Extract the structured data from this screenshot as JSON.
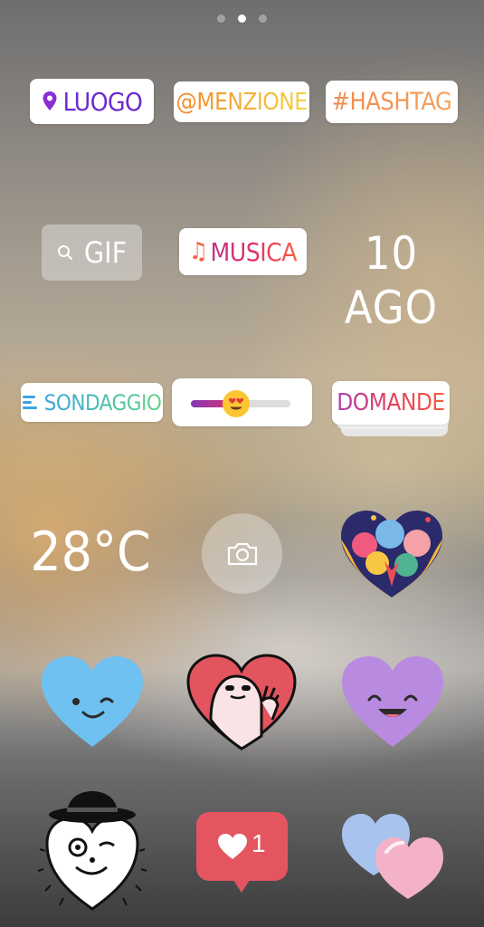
{
  "page_dots": {
    "count": 3,
    "active_index": 1
  },
  "row1": {
    "location": {
      "label": "LUOGO",
      "icon": "location-pin-icon",
      "color": "#6b2bd0"
    },
    "mention": {
      "label": "@MENZIONE"
    },
    "hashtag": {
      "label": "#HASHTAG"
    }
  },
  "row2": {
    "gif": {
      "label": "GIF",
      "icon": "search-icon"
    },
    "music": {
      "label": "MUSICA",
      "icon": "music-note-icon"
    },
    "date": {
      "label": "10 AGO"
    }
  },
  "row3": {
    "poll": {
      "label": "SONDAGGIO",
      "icon": "poll-lines-icon"
    },
    "emoji_slider": {
      "emoji": "heart-eyes-emoji",
      "level": 0.45
    },
    "questions": {
      "label": "DOMANDE"
    }
  },
  "row4": {
    "temperature": {
      "label": "28°C"
    },
    "camera": {
      "icon": "camera-icon"
    },
    "heart_hands": {
      "icon": "heart-hands-sticker"
    }
  },
  "row5": {
    "blue_heart": {
      "icon": "winking-blue-heart-sticker",
      "color": "#6ec1f1"
    },
    "red_heart": {
      "icon": "peeking-character-heart-sticker",
      "color": "#e2555f"
    },
    "purple_heart": {
      "icon": "smiling-purple-heart-sticker",
      "color": "#b98be0"
    }
  },
  "row6": {
    "hat_heart": {
      "icon": "hat-character-heart-sticker"
    },
    "like_badge": {
      "icon": "heart-icon",
      "count": "1",
      "color": "#e55560"
    },
    "pastel_hearts": {
      "icon": "pastel-hearts-sticker"
    }
  }
}
